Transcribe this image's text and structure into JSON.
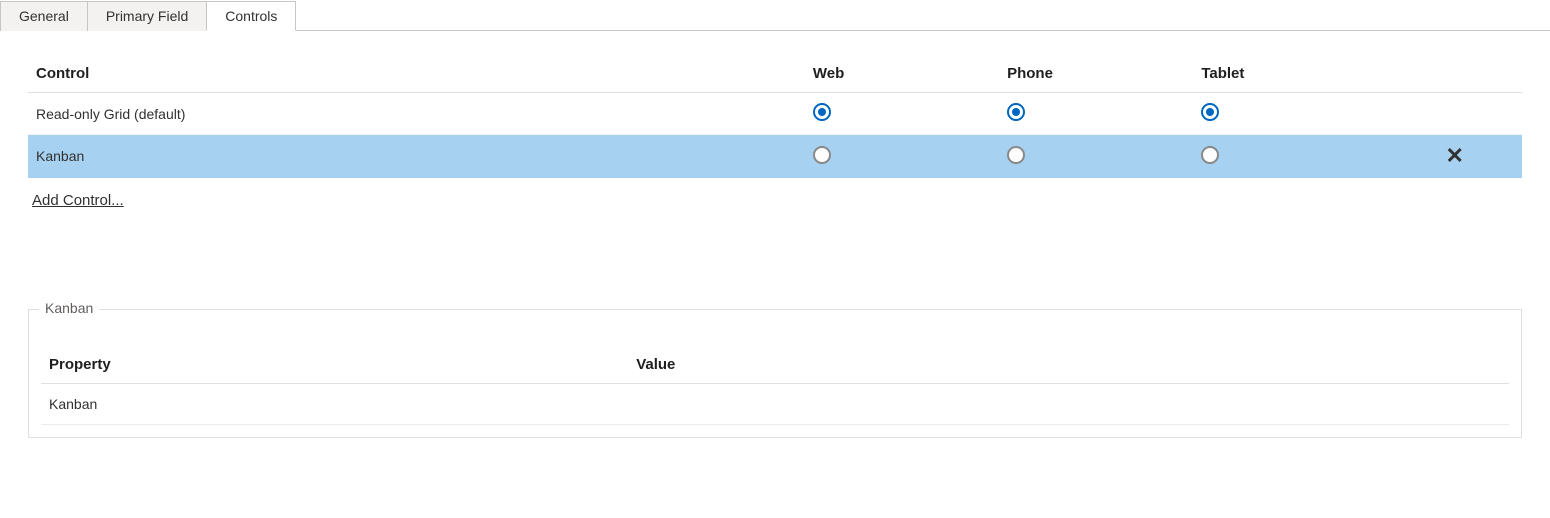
{
  "tabs": [
    {
      "label": "General",
      "active": false
    },
    {
      "label": "Primary Field",
      "active": false
    },
    {
      "label": "Controls",
      "active": true
    }
  ],
  "controlsTable": {
    "headers": {
      "control": "Control",
      "web": "Web",
      "phone": "Phone",
      "tablet": "Tablet"
    },
    "rows": [
      {
        "name": "Read-only Grid (default)",
        "web": true,
        "phone": true,
        "tablet": true,
        "selected": false,
        "deletable": false
      },
      {
        "name": "Kanban",
        "web": false,
        "phone": false,
        "tablet": false,
        "selected": true,
        "deletable": true
      }
    ],
    "addLink": "Add Control..."
  },
  "propsFieldset": {
    "legend": "Kanban",
    "headers": {
      "property": "Property",
      "value": "Value"
    },
    "rows": [
      {
        "property": "Kanban",
        "value": ""
      }
    ]
  }
}
